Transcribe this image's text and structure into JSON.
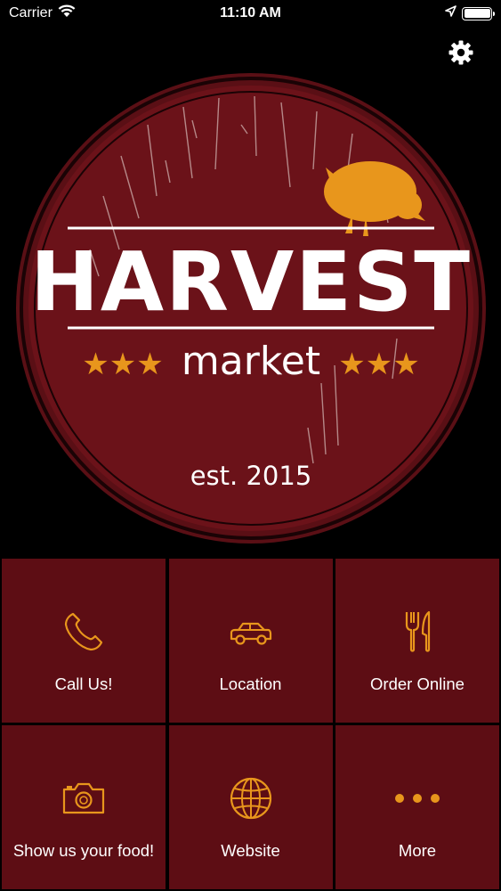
{
  "status_bar": {
    "carrier": "Carrier",
    "time": "11:10 AM"
  },
  "logo": {
    "name": "HARVEST",
    "subtitle": "market",
    "established": "est. 2015",
    "stars_left": "★★★",
    "stars_right": "★★★"
  },
  "colors": {
    "tile_bg": "#5d0d14",
    "logo_bg": "#6b1219",
    "accent": "#e8961c",
    "text": "#ffffff"
  },
  "tiles": [
    {
      "label": "Call Us!",
      "icon": "phone-icon"
    },
    {
      "label": "Location",
      "icon": "car-icon"
    },
    {
      "label": "Order Online",
      "icon": "fork-knife-icon"
    },
    {
      "label": "Show us your food!",
      "icon": "camera-icon"
    },
    {
      "label": "Website",
      "icon": "globe-icon"
    },
    {
      "label": "More",
      "icon": "more-dots-icon"
    }
  ]
}
